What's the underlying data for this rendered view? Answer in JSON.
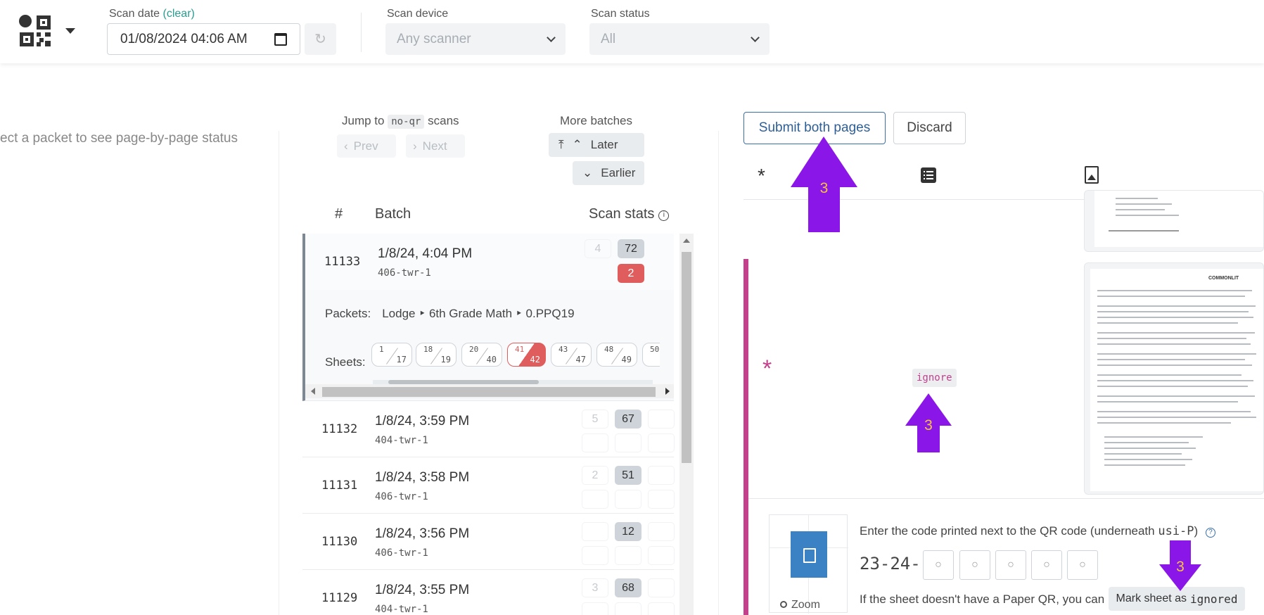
{
  "toolbar": {
    "scan_date_label": "Scan date",
    "clear_label": "(clear)",
    "scan_date_value": "01/08/2024  04:06  AM",
    "scan_device_label": "Scan device",
    "scan_device_value": "Any scanner",
    "scan_status_label": "Scan status",
    "scan_status_value": "All"
  },
  "left_panel": {
    "hint": "ect a packet to see page-by-page status"
  },
  "batch_nav": {
    "jump_to": "Jump to",
    "jump_code": "no-qr",
    "jump_suffix": "scans",
    "prev": "Prev",
    "next": "Next",
    "more_batches": "More batches",
    "later": "Later",
    "earlier": "Earlier"
  },
  "table": {
    "col_num": "#",
    "col_batch": "Batch",
    "col_stats": "Scan stats",
    "expanded": {
      "num": "11133",
      "date": "1/8/24, 4:04 PM",
      "device": "406-twr-1",
      "stat_ghost": "4",
      "stat_total": "72",
      "stat_error": "2",
      "packets_label": "Packets:",
      "packets_value": "Lodge ‣ 6th Grade Math ‣ 0.PPQ19",
      "sheets_label": "Sheets:",
      "sheets": [
        {
          "a": "1",
          "b": "17"
        },
        {
          "a": "18",
          "b": "19"
        },
        {
          "a": "20",
          "b": "40"
        },
        {
          "a": "41",
          "b": "42"
        },
        {
          "a": "43",
          "b": "47"
        },
        {
          "a": "48",
          "b": "49"
        },
        {
          "a": "50",
          "b": ""
        }
      ]
    },
    "rows": [
      {
        "num": "11132",
        "date": "1/8/24, 3:59 PM",
        "device": "404-twr-1",
        "ghost": "5",
        "total": "67"
      },
      {
        "num": "11131",
        "date": "1/8/24, 3:58 PM",
        "device": "406-twr-1",
        "ghost": "2",
        "total": "51"
      },
      {
        "num": "11130",
        "date": "1/8/24, 3:56 PM",
        "device": "406-twr-1",
        "ghost": "",
        "total": "12"
      },
      {
        "num": "11129",
        "date": "1/8/24, 3:55 PM",
        "device": "404-twr-1",
        "ghost": "3",
        "total": "68"
      }
    ]
  },
  "review": {
    "submit": "Submit both pages",
    "discard": "Discard",
    "tab_asterisk": "*",
    "ignore_chip": "ignore",
    "card_asterisk": "*",
    "instruction_prefix": "Enter the code printed next to the QR code (underneath",
    "instruction_code": "usi-P",
    "instruction_suffix": ")",
    "code_prefix": "23-24-",
    "code_placeholder": "○",
    "no_qr_text": "If the sheet doesn't have a Paper QR, you can",
    "mark_label": "Mark sheet as",
    "mark_code": "ignored",
    "zoom": "Zoom",
    "doc_brand": "COMMONLIT"
  },
  "annotations": {
    "number": "3",
    "color": "#8a17e8"
  },
  "colors": {
    "accent_pink": "#c4408c",
    "error_red": "#e05d5d",
    "primary_blue": "#2d5f96"
  }
}
